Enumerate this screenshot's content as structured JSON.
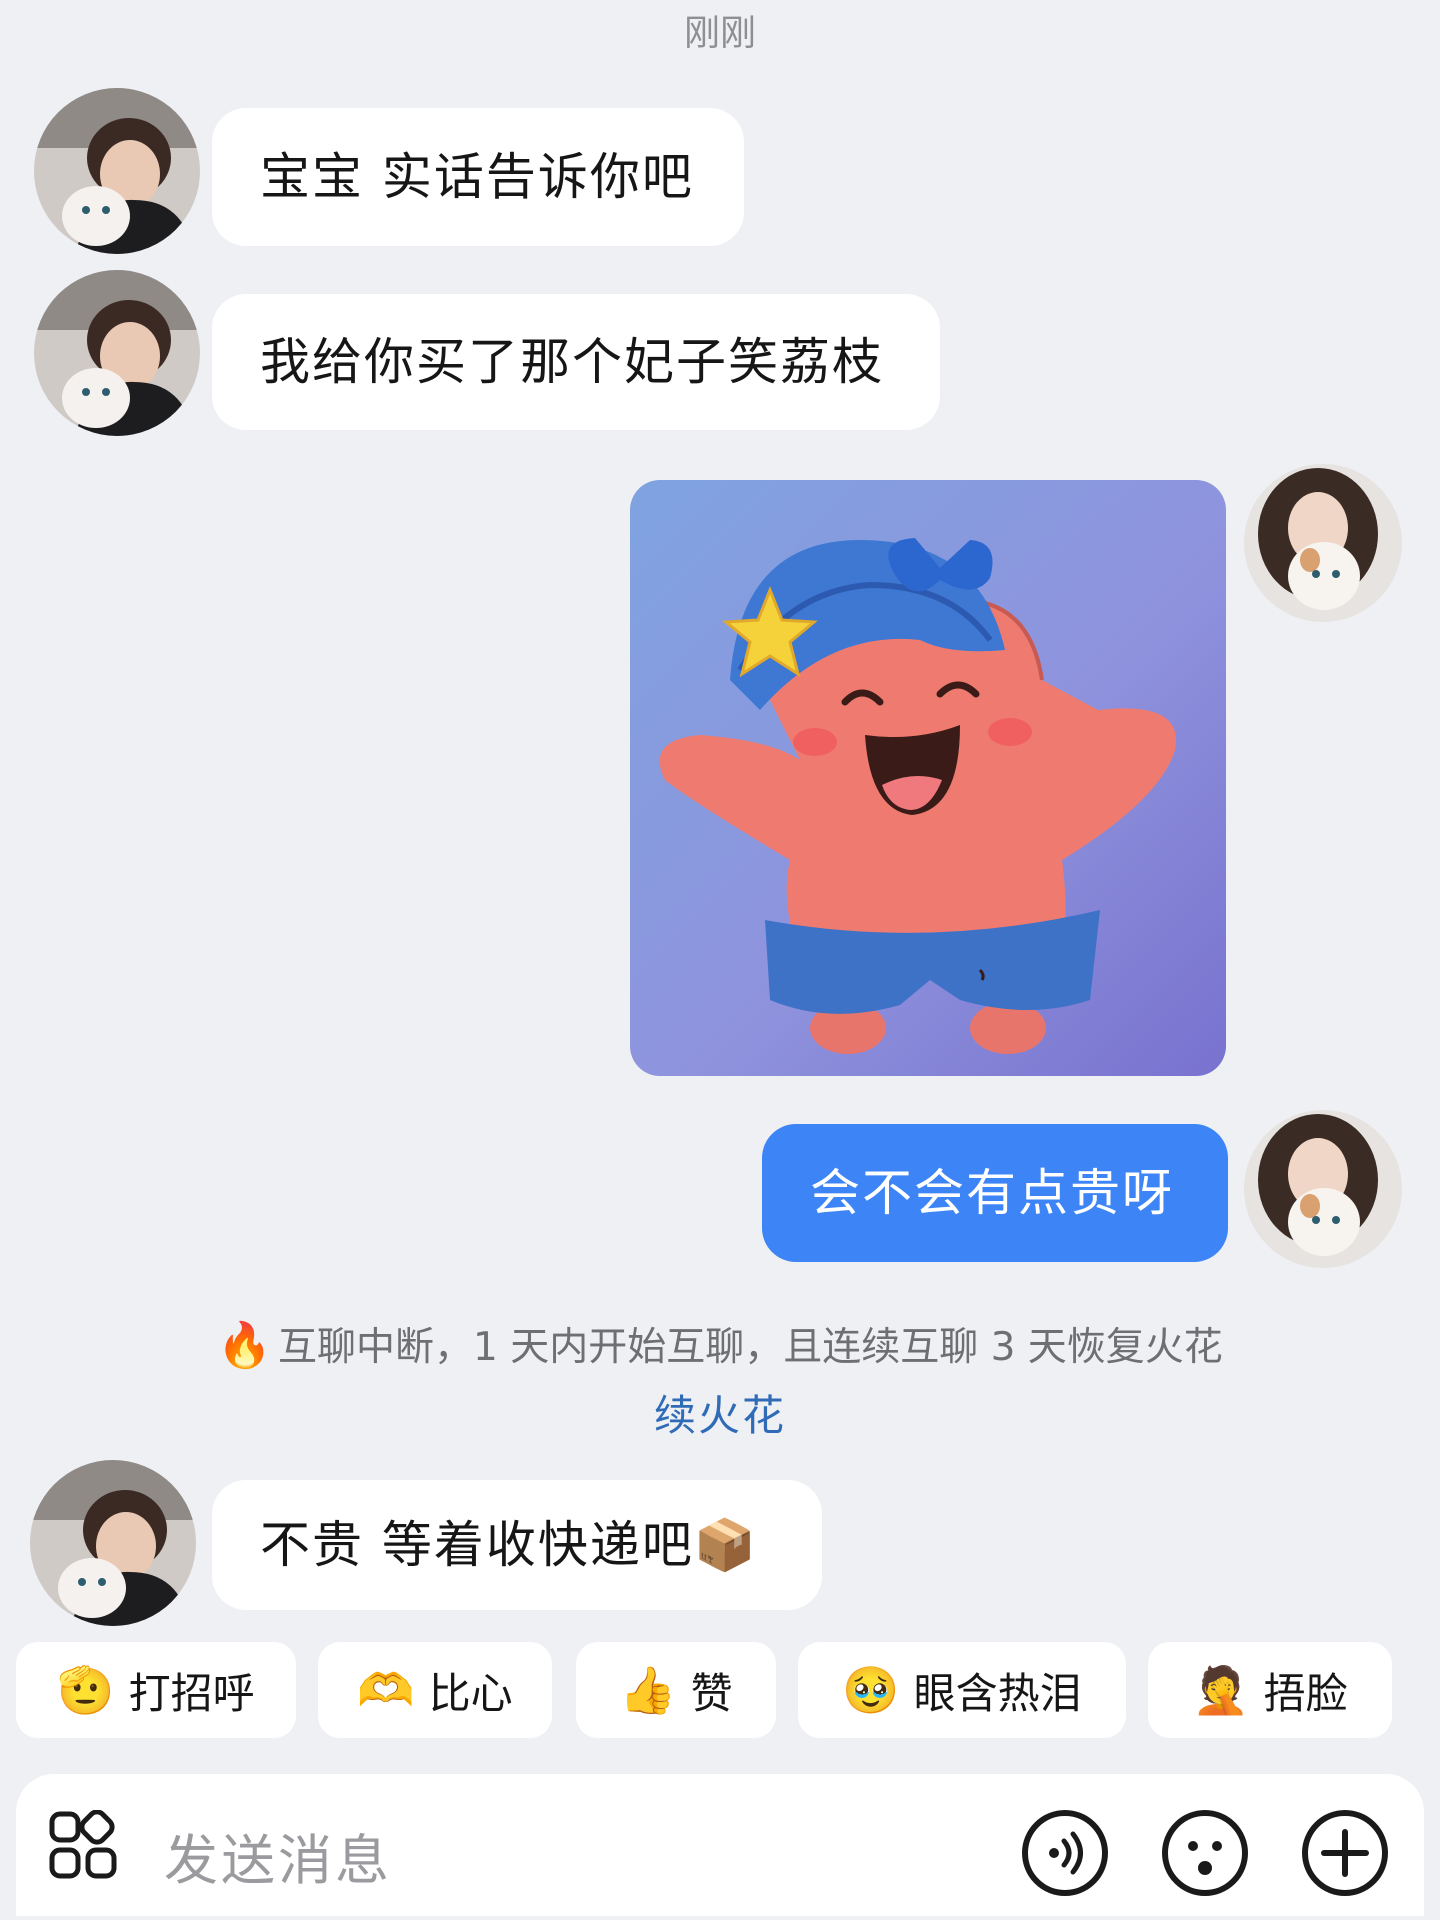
{
  "header": {
    "timestamp": "刚刚"
  },
  "messages": [
    {
      "side": "left",
      "text": "宝宝 实话告诉你吧"
    },
    {
      "side": "left",
      "text": "我给你买了那个妃子笑荔枝"
    },
    {
      "side": "right",
      "type": "sticker",
      "sticker": "happy-starfish-sticker"
    },
    {
      "side": "right",
      "text": "会不会有点贵呀"
    },
    {
      "side": "left",
      "text": "不贵 等着收快递吧📦"
    }
  ],
  "system_notice": {
    "icon": "fire-icon",
    "text": "互聊中断，1 天内开始互聊，且连续互聊 3 天恢复火花",
    "link": "续火花"
  },
  "quick_replies": [
    {
      "emoji": "🫡",
      "label": "打招呼"
    },
    {
      "emoji": "🫶",
      "label": "比心"
    },
    {
      "emoji": "👍",
      "label": "赞"
    },
    {
      "emoji": "🥹",
      "label": "眼含热泪"
    },
    {
      "emoji": "🤦",
      "label": "捂脸"
    }
  ],
  "input": {
    "placeholder": "发送消息"
  },
  "colors": {
    "my_bubble": "#3d84f7",
    "link": "#2f6bb6",
    "background": "#eef0f4"
  }
}
